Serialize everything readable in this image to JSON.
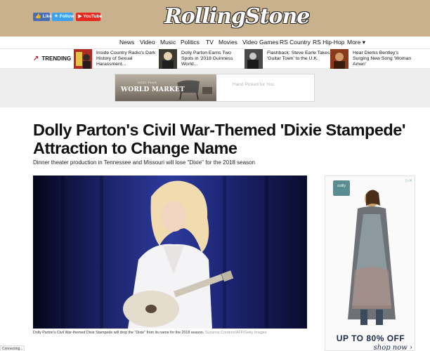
{
  "header": {
    "logo": "RollingStone",
    "social": {
      "like": "Like",
      "follow": "Follow",
      "youtube": "YouTube"
    }
  },
  "nav": {
    "items": [
      "News",
      "Video",
      "Music",
      "Politics",
      "TV",
      "Movies",
      "Video Games",
      "RS Country",
      "RS Hip-Hop",
      "More ▾"
    ]
  },
  "trending": {
    "label": "TRENDING",
    "items": [
      {
        "text": "Inside Country Radio's Dark History of Sexual Harassment..."
      },
      {
        "text": "Dolly Parton Earns Two Spots in '2018 Guinness World..."
      },
      {
        "text": "Flashback: Steve Earle Takes 'Guitar Town' to the U.K."
      },
      {
        "text": "Hear Dierks Bentley's Surging New Song 'Woman Amen'"
      }
    ]
  },
  "top_ad": {
    "brand": "WORLD MARKET",
    "cost": "COST PLUS",
    "tagline": "Hand Picked for You"
  },
  "article": {
    "headline": "Dolly Parton's Civil War-Themed 'Dixie Stampede' Attraction to Change Name",
    "subhead": "Dinner theater production in Tennessee and Missouri will lose \"Dixie\" for the 2018 season",
    "caption": "Dolly Parton's Civil War-themed Dixie Stampede will drop the \"Dixie\" from its name for the 2018 season.",
    "credit": "Suzanne Cordeiro/AFP/Getty Images"
  },
  "side_ad": {
    "brand": "zulily",
    "offer": "UP TO 80% OFF",
    "cta": "shop now ›"
  },
  "status": "Connecting..."
}
